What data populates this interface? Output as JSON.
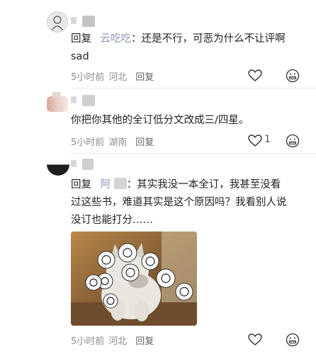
{
  "comments": [
    {
      "reply_prefix": "回复",
      "mention": "云吃吃",
      "colon": "：",
      "text": "还是不行，可恶为什么不让评啊",
      "text2": "sad",
      "time": "5小时前",
      "location": "河北",
      "reply_label": "回复"
    },
    {
      "text": "你把你其他的全订低分文改成三/四星。",
      "time": "5小时前",
      "location": "湖南",
      "reply_label": "回复",
      "likes": "1"
    },
    {
      "reply_prefix": "回复",
      "mention": "阿",
      "colon": "：",
      "text_line1": "其实我没一本全订，我甚至没看",
      "text_line2": "过这些书，难道其实是这个原因吗？我看别人说",
      "text_line3": "没订也能打分……",
      "time": "5小时前",
      "location": "河北",
      "reply_label": "回复"
    }
  ],
  "icons": {
    "like": "heart-outline-icon",
    "dislike": "grimace-face-icon"
  }
}
